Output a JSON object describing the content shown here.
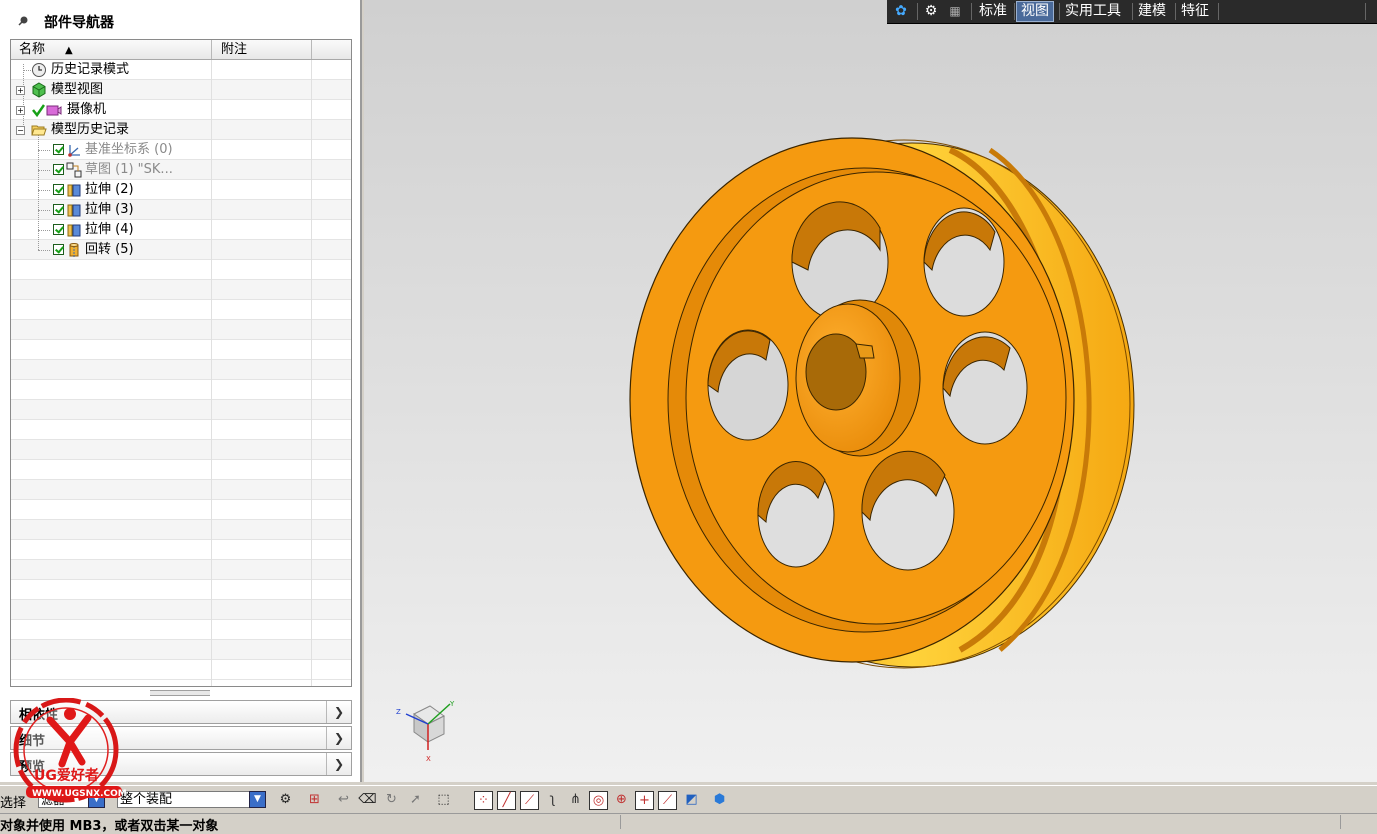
{
  "navigator": {
    "title": "部件导航器",
    "columns": {
      "name": "名称",
      "note": "附注"
    },
    "rows": [
      {
        "label": "历史记录模式",
        "icon": "clock-icon"
      },
      {
        "label": "模型视图",
        "icon": "model-views-icon"
      },
      {
        "label": "摄像机",
        "icon": "camera-icon"
      },
      {
        "label": "模型历史记录",
        "icon": "folder-open-icon"
      },
      {
        "label": "基准坐标系 (0)",
        "icon": "datum-csys-icon"
      },
      {
        "label": "草图 (1) \"SK...",
        "icon": "sketch-icon"
      },
      {
        "label": "拉伸 (2)",
        "icon": "extrude-icon"
      },
      {
        "label": "拉伸 (3)",
        "icon": "extrude-icon"
      },
      {
        "label": "拉伸 (4)",
        "icon": "extrude-icon"
      },
      {
        "label": "回转 (5)",
        "icon": "revolve-icon"
      }
    ],
    "panels": [
      "相依性",
      "细节",
      "预览"
    ]
  },
  "top_toolbar": {
    "tabs": [
      "标准",
      "视图",
      "实用工具",
      "建模",
      "特征"
    ],
    "active_tab": "视图"
  },
  "bottom_toolbar": {
    "filter_label": "选择",
    "filter_value": "滤器",
    "scope_value": "整个装配"
  },
  "status": {
    "message": "对象并使用 MB3，或者双击某一对象"
  },
  "triad": {
    "x": "X",
    "y": "Y",
    "z": "Z"
  },
  "watermark": {
    "brand": "UG爱好者",
    "url": "WWW.UGSNX.COM"
  },
  "colors": {
    "part": "#f59a10",
    "part_light": "#ffc82a",
    "active_tab": "#4a6a9a",
    "check": "#17a017"
  }
}
